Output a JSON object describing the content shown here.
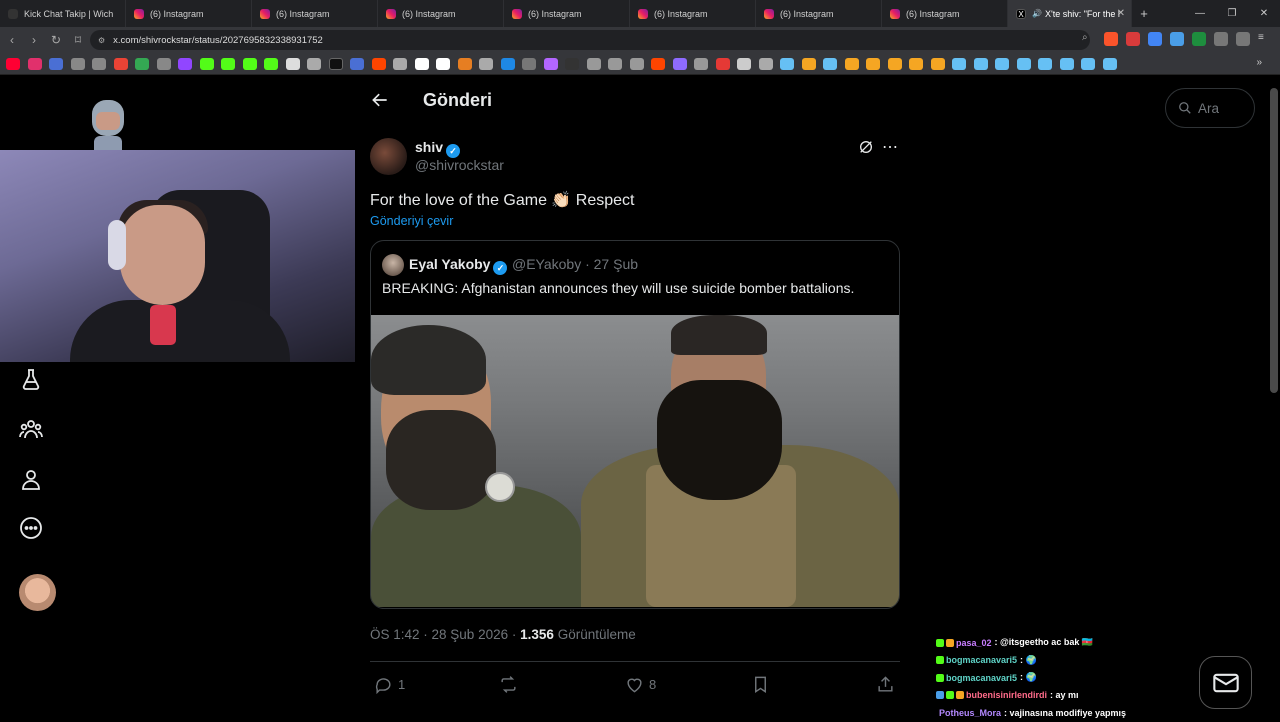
{
  "browser": {
    "tabs": [
      {
        "label": "Kick Chat Takip | Wich",
        "icon": "kick-icon"
      },
      {
        "label": "(6) Instagram",
        "icon": "instagram-icon"
      },
      {
        "label": "(6) Instagram",
        "icon": "instagram-icon"
      },
      {
        "label": "(6) Instagram",
        "icon": "instagram-icon"
      },
      {
        "label": "(6) Instagram",
        "icon": "instagram-icon"
      },
      {
        "label": "(6) Instagram",
        "icon": "instagram-icon"
      },
      {
        "label": "(6) Instagram",
        "icon": "instagram-icon"
      },
      {
        "label": "(6) Instagram",
        "icon": "instagram-icon"
      },
      {
        "label": "X'te shiv: \"For the l",
        "icon": "x-icon",
        "active": true
      }
    ],
    "new_tab": "+",
    "url": "x.com/shivrockstar/status/2027695832338931752"
  },
  "header": {
    "back": "←",
    "title": "Gönderi"
  },
  "search": {
    "placeholder": "Ara"
  },
  "tweet": {
    "author_name": "shiv",
    "author_handle": "@shivrockstar",
    "verified": true,
    "text": "For the love of the Game 👏🏻 Respect",
    "translate": "Gönderiyi çevir",
    "quote": {
      "author_name": "Eyal Yakoby",
      "meta": "@EYakoby · 27 Şub",
      "text": "BREAKING: Afghanistan announces they will use suicide bomber battalions."
    },
    "time": "ÖS 1:42 · 28 Şub 2026 ·",
    "views": "1.356",
    "views_label": "Görüntüleme",
    "replies": "1",
    "likes": "8"
  },
  "chat": [
    {
      "user": "pasa_02",
      "color": "#c77dff",
      "msg": ": @itsgeetho ac bak 🇦🇿"
    },
    {
      "user": "bogmacanavari5",
      "color": "#5fd3c7",
      "msg": ": 🌍"
    },
    {
      "user": "bogmacanavari5",
      "color": "#5fd3c7",
      "msg": ": 🌍"
    },
    {
      "user": "bubenisinirlendirdi",
      "color": "#ff6b8a",
      "msg": ": ay mı"
    },
    {
      "user": "Potheus_Mora",
      "color": "#b388ff",
      "msg": ": vajinasına modifiye yapmış"
    }
  ],
  "colors": {
    "accent": "#1d9bf0",
    "muted": "#71767b",
    "text": "#e7e9ea"
  }
}
